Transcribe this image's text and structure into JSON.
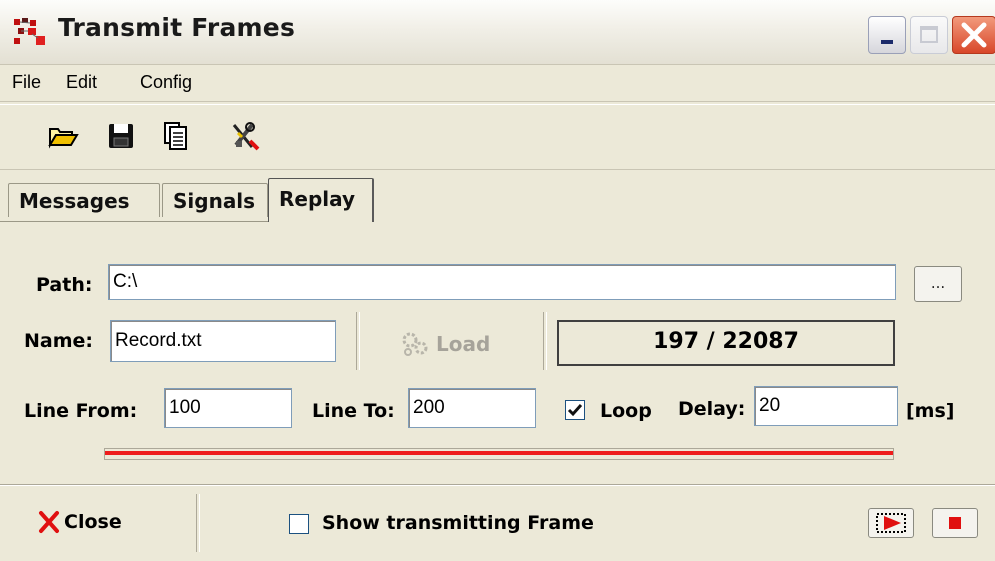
{
  "window": {
    "title": "Transmit Frames",
    "app_icon": "network-frames-icon"
  },
  "menu": [
    "File",
    "Edit",
    "Config"
  ],
  "toolbar": {
    "icons": [
      "open-folder-icon",
      "save-floppy-icon",
      "copy-pages-icon",
      "tools-settings-icon"
    ]
  },
  "tabs": [
    {
      "label": "Messages",
      "active": false
    },
    {
      "label": "Signals",
      "active": false
    },
    {
      "label": "Replay",
      "active": true
    }
  ],
  "replay": {
    "path_label": "Path:",
    "path_value": "C:\\",
    "browse_label": "...",
    "name_label": "Name:",
    "name_value": "Record.txt",
    "load_label": "Load",
    "counter_text": "197 / 22087",
    "line_from_label": "Line From:",
    "line_from_value": "100",
    "line_to_label": "Line To:",
    "line_to_value": "200",
    "loop_label": "Loop",
    "loop_checked": true,
    "delay_label": "Delay:",
    "delay_value": "20",
    "delay_unit": "[ms]",
    "progress_fraction": 1.0,
    "progress_color": "#ee1c1c"
  },
  "footer": {
    "close_label": "Close",
    "show_frame_label": "Show transmitting Frame",
    "show_frame_checked": false
  },
  "colors": {
    "accent_red": "#ee1c1c",
    "face": "#ece9d8"
  }
}
